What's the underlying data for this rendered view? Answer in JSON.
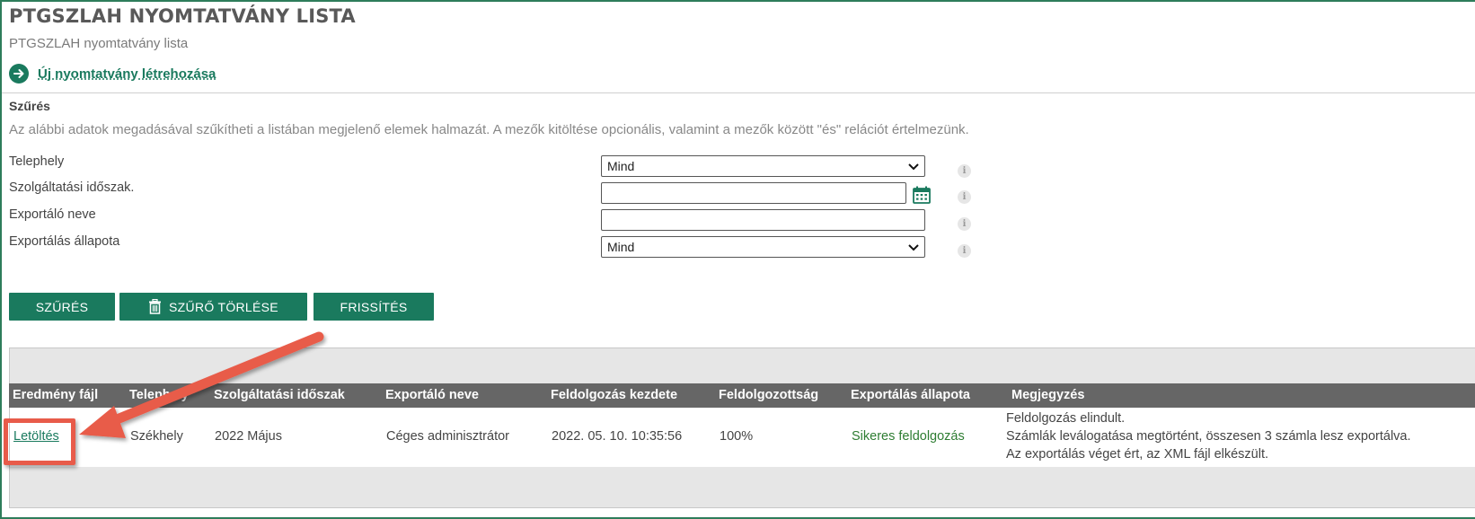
{
  "page": {
    "title": "PTGSZLAH NYOMTATVÁNY LISTA",
    "subtitle": "PTGSZLAH nyomtatvány lista",
    "new_form_link": "Új nyomtatvány létrehozása"
  },
  "filter": {
    "title": "Szűrés",
    "description": "Az alábbi adatok megadásával szűkítheti a listában megjelenő elemek halmazát. A mezők kitöltése opcionális, valamint a mezők között \"és\" relációt értelmezünk.",
    "fields": {
      "site": {
        "label": "Telephely",
        "value": "Mind"
      },
      "period": {
        "label": "Szolgáltatási időszak.",
        "value": ""
      },
      "exporter": {
        "label": "Exportáló neve",
        "value": ""
      },
      "status": {
        "label": "Exportálás állapota",
        "value": "Mind"
      }
    },
    "info_glyph": "i"
  },
  "buttons": {
    "filter": "SZŰRÉS",
    "clear": "SZŰRŐ TÖRLÉSE",
    "refresh": "FRISSÍTÉS"
  },
  "table": {
    "headers": [
      "Eredmény fájl",
      "Telephely",
      "Szolgáltatási időszak",
      "Exportáló neve",
      "Feldolgozás kezdete",
      "Feldolgozottság",
      "Exportálás állapota",
      "Megjegyzés"
    ],
    "row": {
      "file": "Letöltés",
      "site": "Székhely",
      "period": "2022 Május",
      "exporter": "Céges adminisztrátor",
      "start": "2022. 05. 10. 10:35:56",
      "progress": "100%",
      "status": "Sikeres feldolgozás",
      "notes": [
        "Feldolgozás elindult.",
        "Számlák leválogatása megtörtént, összesen 3 számla lesz exportálva.",
        "Az exportálás véget ért, az XML fájl elkészült."
      ]
    }
  },
  "colors": {
    "brand_green": "#1a7a5e",
    "header_gray": "#666666",
    "highlight_red": "#e85b4a"
  },
  "icons": [
    "arrow-right-circle-icon",
    "calendar-icon",
    "info-icon",
    "trash-icon",
    "chevron-down-icon"
  ]
}
